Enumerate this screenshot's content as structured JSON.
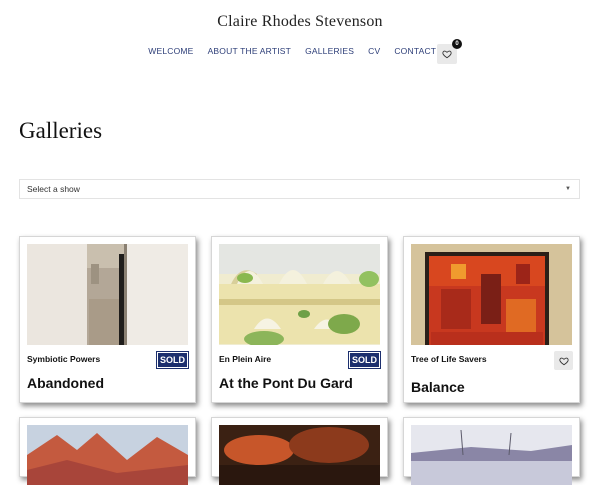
{
  "site": {
    "title": "Claire Rhodes Stevenson"
  },
  "nav": {
    "items": [
      "WELCOME",
      "ABOUT THE ARTIST",
      "GALLERIES",
      "CV",
      "CONTACT ME"
    ],
    "favorites_count": "0",
    "favorites_icon": "heart-icon"
  },
  "page": {
    "title": "Galleries"
  },
  "filter": {
    "selected": "Select a show",
    "icon": "caret-down-icon"
  },
  "artworks": [
    {
      "series": "Symbiotic Powers",
      "title": "Abandoned",
      "badge": "SOLD"
    },
    {
      "series": "En Plein Aire",
      "title": "At the Pont Du Gard",
      "badge": "SOLD"
    },
    {
      "series": "Tree of Life Savers",
      "title": "Balance",
      "badge": ""
    }
  ],
  "colors": {
    "nav_link": "#2d3e78",
    "sold_badge": "#1c2f6e"
  }
}
